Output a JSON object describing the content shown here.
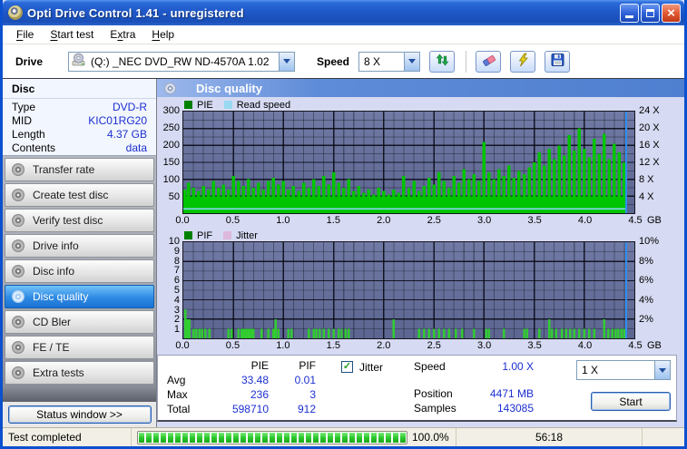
{
  "window": {
    "title": "Opti Drive Control 1.41 - unregistered"
  },
  "menu": {
    "items": [
      {
        "label": "File",
        "underline": 0
      },
      {
        "label": "Start test",
        "underline": 0
      },
      {
        "label": "Extra",
        "underline": 1
      },
      {
        "label": "Help",
        "underline": 0
      }
    ]
  },
  "toolbar": {
    "drive_label": "Drive",
    "drive_value": "(Q:)  _NEC DVD_RW ND-4570A 1.02",
    "speed_label": "Speed",
    "speed_value": "8 X",
    "buttons": [
      {
        "name": "refresh-drives-button",
        "icon": "refresh-arrows-icon"
      },
      {
        "name": "erase-disc-button",
        "icon": "eraser-icon"
      },
      {
        "name": "quick-scan-button",
        "icon": "lightning-icon"
      },
      {
        "name": "save-results-button",
        "icon": "floppy-disk-icon"
      }
    ]
  },
  "sidebar": {
    "disc_header": "Disc",
    "disc_info": [
      {
        "label": "Type",
        "value": "DVD-R"
      },
      {
        "label": "MID",
        "value": "KIC01RG20"
      },
      {
        "label": "Length",
        "value": "4.37 GB"
      },
      {
        "label": "Contents",
        "value": "data"
      }
    ],
    "nav": [
      {
        "label": "Transfer rate",
        "active": false
      },
      {
        "label": "Create test disc",
        "active": false
      },
      {
        "label": "Verify test disc",
        "active": false
      },
      {
        "label": "Drive info",
        "active": false
      },
      {
        "label": "Disc info",
        "active": false
      },
      {
        "label": "Disc quality",
        "active": true
      },
      {
        "label": "CD Bler",
        "active": false
      },
      {
        "label": "FE / TE",
        "active": false
      },
      {
        "label": "Extra tests",
        "active": false
      }
    ],
    "status_window_label": "Status window >>"
  },
  "main": {
    "header": "Disc quality"
  },
  "stats": {
    "col_headers": [
      "PIE",
      "PIF"
    ],
    "rows": [
      {
        "label": "Avg",
        "pie": "33.48",
        "pif": "0.01"
      },
      {
        "label": "Max",
        "pie": "236",
        "pif": "3"
      },
      {
        "label": "Total",
        "pie": "598710",
        "pif": "912"
      }
    ],
    "jitter_label": "Jitter",
    "jitter_checked": true,
    "check_glyph": "✓",
    "info": [
      {
        "label": "Speed",
        "value": "1.00 X"
      },
      {
        "label": "Position",
        "value": "4471 MB"
      },
      {
        "label": "Samples",
        "value": "143085"
      }
    ],
    "speed_select": "1 X",
    "start_label": "Start"
  },
  "statusbar": {
    "status": "Test completed",
    "percent": "100.0%",
    "time": "56:18",
    "progress_fraction": 1.0,
    "segments": 38
  },
  "chart_data": [
    {
      "type": "area",
      "title": "PIE / Read speed",
      "legend": [
        {
          "label": "PIE",
          "color": "#008000"
        },
        {
          "label": "Read speed",
          "color": "#99d9f0"
        }
      ],
      "x_unit": "GB",
      "xlim": [
        0,
        4.5
      ],
      "x_ticks": [
        "0.0",
        "0.5",
        "1.0",
        "1.5",
        "2.0",
        "2.5",
        "3.0",
        "3.5",
        "4.0",
        "4.5"
      ],
      "y_left": {
        "min": 0,
        "max": 300,
        "ticks": [
          300,
          250,
          200,
          150,
          100,
          50
        ]
      },
      "y_right": {
        "min": 0,
        "max": 24,
        "ticks": [
          "24 X",
          "20 X",
          "16 X",
          "12 X",
          "8 X",
          "4 X"
        ]
      },
      "grid": {
        "x_minor": 0.1,
        "x_major": 0.5,
        "y_minor": 25,
        "y_major": 50
      },
      "vh": 300,
      "pie_series": {
        "name": "PIE",
        "color": "#00c400",
        "x_start": 0,
        "x_step": 0.05,
        "values": [
          70,
          90,
          75,
          65,
          80,
          70,
          95,
          75,
          85,
          70,
          110,
          95,
          80,
          100,
          75,
          90,
          70,
          95,
          105,
          85,
          95,
          70,
          80,
          65,
          90,
          75,
          100,
          80,
          110,
          85,
          120,
          90,
          75,
          100,
          65,
          80,
          60,
          70,
          55,
          75,
          65,
          55,
          70,
          60,
          110,
          75,
          95,
          65,
          80,
          105,
          85,
          120,
          95,
          75,
          110,
          90,
          130,
          100,
          115,
          95,
          210,
          120,
          100,
          130,
          110,
          140,
          105,
          125,
          115,
          135,
          150,
          180,
          140,
          190,
          160,
          200,
          170,
          230,
          185,
          250,
          190,
          165,
          220,
          175,
          235,
          160,
          205,
          180,
          150
        ]
      },
      "read_speed": {
        "name": "Read speed",
        "color": "#8ed8f8",
        "constant_x_speed": 1.0,
        "end_gb": 4.42
      },
      "position_marker_gb": 4.42,
      "marker_color": "#2f8ef0"
    },
    {
      "type": "bar",
      "title": "PIF / Jitter",
      "legend": [
        {
          "label": "PIF",
          "color": "#008000"
        },
        {
          "label": "Jitter",
          "color": "#dcb8dc"
        }
      ],
      "x_unit": "GB",
      "xlim": [
        0,
        4.5
      ],
      "x_ticks": [
        "0.0",
        "0.5",
        "1.0",
        "1.5",
        "2.0",
        "2.5",
        "3.0",
        "3.5",
        "4.0",
        "4.5"
      ],
      "y_left": {
        "min": 0,
        "max": 10,
        "ticks": [
          10,
          9,
          8,
          7,
          6,
          5,
          4,
          3,
          2,
          1
        ]
      },
      "y_right": {
        "min": 0,
        "max": 10,
        "ticks": [
          "10%",
          "8%",
          "6%",
          "4%",
          "2%"
        ]
      },
      "grid": {
        "x_minor": 0.1,
        "x_major": 0.5,
        "y_minor": 1,
        "y_major": 2
      },
      "vh": 100,
      "pif_series": {
        "name": "PIF",
        "color": "#30cc30",
        "points": [
          [
            0.02,
            3
          ],
          [
            0.04,
            2
          ],
          [
            0.06,
            2
          ],
          [
            0.1,
            1
          ],
          [
            0.13,
            1
          ],
          [
            0.16,
            1
          ],
          [
            0.19,
            1
          ],
          [
            0.22,
            1
          ],
          [
            0.26,
            1
          ],
          [
            0.45,
            1
          ],
          [
            0.48,
            1
          ],
          [
            0.55,
            1
          ],
          [
            0.58,
            1
          ],
          [
            0.6,
            1
          ],
          [
            0.62,
            1
          ],
          [
            0.64,
            1
          ],
          [
            0.66,
            1
          ],
          [
            0.68,
            1
          ],
          [
            0.7,
            1
          ],
          [
            0.78,
            1
          ],
          [
            0.85,
            1
          ],
          [
            0.9,
            1
          ],
          [
            0.92,
            2
          ],
          [
            0.95,
            1
          ],
          [
            1.05,
            1
          ],
          [
            1.08,
            1
          ],
          [
            1.25,
            1
          ],
          [
            1.3,
            1
          ],
          [
            1.33,
            1
          ],
          [
            1.36,
            1
          ],
          [
            1.4,
            1
          ],
          [
            1.45,
            1
          ],
          [
            1.5,
            1
          ],
          [
            1.55,
            1
          ],
          [
            1.58,
            1
          ],
          [
            1.62,
            1
          ],
          [
            1.65,
            1
          ],
          [
            2.1,
            2
          ],
          [
            2.35,
            1
          ],
          [
            2.4,
            1
          ],
          [
            2.45,
            1
          ],
          [
            2.5,
            1
          ],
          [
            2.55,
            1
          ],
          [
            2.6,
            1
          ],
          [
            2.65,
            1
          ],
          [
            2.72,
            1
          ],
          [
            2.78,
            1
          ],
          [
            2.9,
            1
          ],
          [
            3.02,
            1
          ],
          [
            3.05,
            1
          ],
          [
            3.2,
            1
          ],
          [
            3.4,
            1
          ],
          [
            3.43,
            1
          ],
          [
            3.55,
            1
          ],
          [
            3.65,
            2
          ],
          [
            3.68,
            1
          ],
          [
            3.72,
            1
          ],
          [
            3.78,
            1
          ],
          [
            3.82,
            1
          ],
          [
            3.86,
            1
          ],
          [
            3.9,
            1
          ],
          [
            3.95,
            1
          ],
          [
            4.0,
            1
          ],
          [
            4.05,
            1
          ],
          [
            4.1,
            1
          ],
          [
            4.2,
            2
          ],
          [
            4.24,
            1
          ],
          [
            4.28,
            1
          ],
          [
            4.31,
            1
          ],
          [
            4.34,
            1
          ],
          [
            4.37,
            1
          ],
          [
            4.4,
            1
          ]
        ]
      },
      "position_marker_gb": 4.42,
      "marker_color": "#2f8ef0"
    }
  ]
}
